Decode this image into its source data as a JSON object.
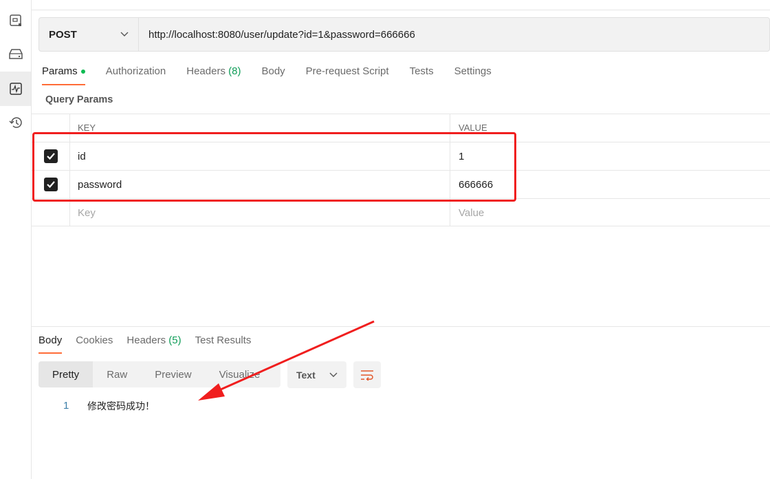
{
  "sidebar": {
    "items": [
      "collections-icon",
      "environments-icon",
      "monitors-icon",
      "history-icon"
    ],
    "active": 2
  },
  "request": {
    "method": "POST",
    "url": "http://localhost:8080/user/update?id=1&password=666666"
  },
  "tabs": [
    {
      "label": "Params"
    },
    {
      "label": "Authorization"
    },
    {
      "label": "Headers",
      "count": "(8)"
    },
    {
      "label": "Body"
    },
    {
      "label": "Pre-request Script"
    },
    {
      "label": "Tests"
    },
    {
      "label": "Settings"
    }
  ],
  "query_params": {
    "title": "Query Params",
    "headers": {
      "key": "KEY",
      "value": "VALUE"
    },
    "rows": [
      {
        "checked": true,
        "key": "id",
        "value": "1"
      },
      {
        "checked": true,
        "key": "password",
        "value": "666666"
      }
    ],
    "placeholder": {
      "key": "Key",
      "value": "Value"
    }
  },
  "response": {
    "tabs": [
      {
        "label": "Body"
      },
      {
        "label": "Cookies"
      },
      {
        "label": "Headers",
        "count": "(5)"
      },
      {
        "label": "Test Results"
      }
    ],
    "views": [
      "Pretty",
      "Raw",
      "Preview",
      "Visualize"
    ],
    "format": "Text",
    "lines": [
      {
        "num": "1",
        "text": "修改密码成功！"
      }
    ]
  },
  "colors": {
    "accent": "#ff6c37",
    "annotation": "#f01e1e",
    "count": "#0f9d58"
  }
}
